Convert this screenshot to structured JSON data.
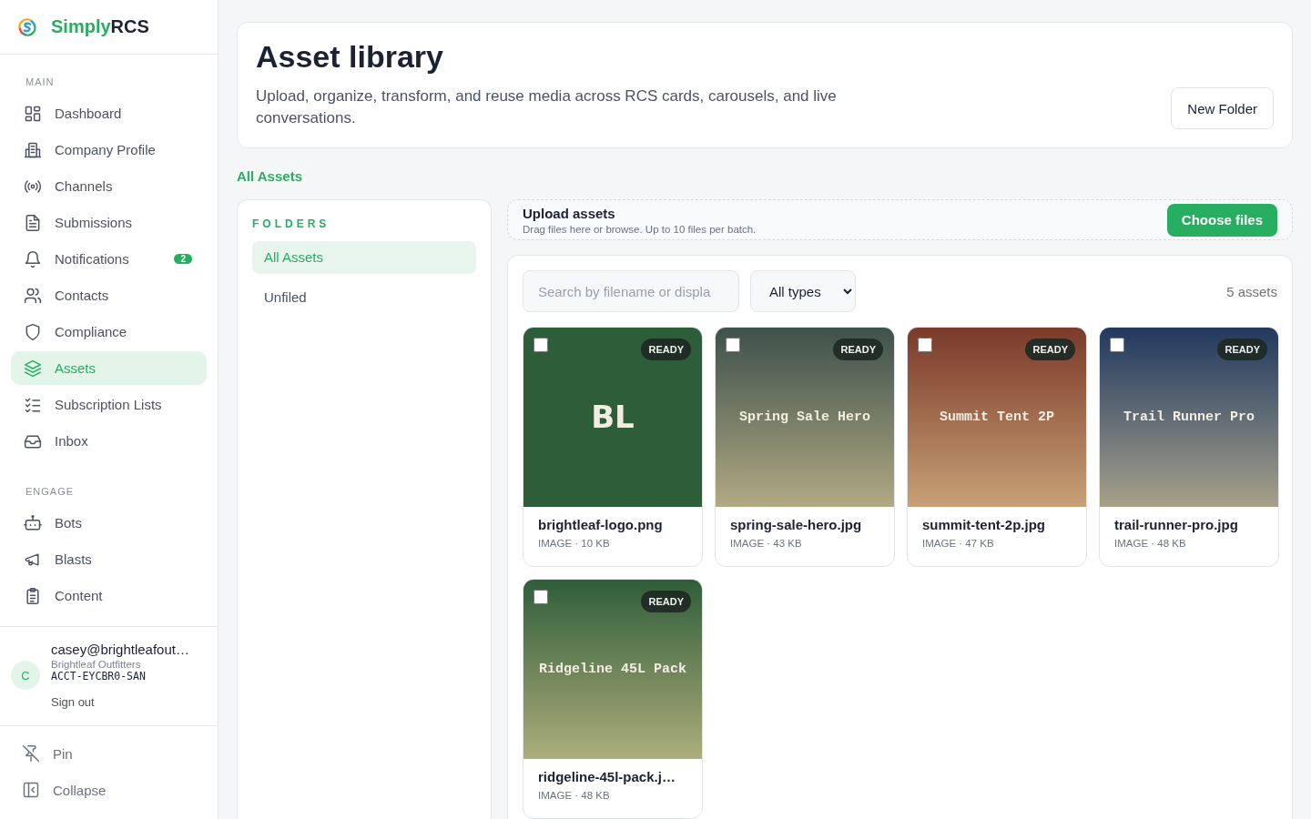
{
  "brand": {
    "name_part1": "Simply",
    "name_part2": "RCS"
  },
  "sidebar": {
    "sections": [
      {
        "label": "MAIN",
        "items": [
          {
            "label": "Dashboard",
            "selected": false
          },
          {
            "label": "Company Profile",
            "selected": false
          },
          {
            "label": "Channels",
            "selected": false
          },
          {
            "label": "Submissions",
            "selected": false
          },
          {
            "label": "Notifications",
            "selected": false,
            "badge": "2"
          },
          {
            "label": "Contacts",
            "selected": false
          },
          {
            "label": "Compliance",
            "selected": false
          },
          {
            "label": "Assets",
            "selected": true
          },
          {
            "label": "Subscription Lists",
            "selected": false
          },
          {
            "label": "Inbox",
            "selected": false
          }
        ]
      },
      {
        "label": "ENGAGE",
        "items": [
          {
            "label": "Bots",
            "selected": false
          },
          {
            "label": "Blasts",
            "selected": false
          },
          {
            "label": "Content",
            "selected": false
          }
        ]
      }
    ],
    "user": {
      "avatar": "C",
      "email": "casey@brightleafout…",
      "company": "Brightleaf Outfitters",
      "account": "ACCT-EYCBR0-SAN",
      "sign_out": "Sign out"
    },
    "footer": [
      {
        "label": "Pin"
      },
      {
        "label": "Collapse"
      }
    ]
  },
  "header": {
    "title": "Asset library",
    "subtitle": "Upload, organize, transform, and reuse media across RCS cards, carousels, and live conversations.",
    "button": "New Folder"
  },
  "breadcrumb": "All Assets",
  "folders": {
    "title": "FOLDERS",
    "items": [
      {
        "label": "All Assets",
        "selected": true
      },
      {
        "label": "Unfiled",
        "selected": false
      }
    ]
  },
  "upload": {
    "title": "Upload assets",
    "hint": "Drag files here or browse. Up to 10 files per batch.",
    "button": "Choose files"
  },
  "toolbar": {
    "search_placeholder": "Search by filename or displa",
    "type_filter": "All types",
    "count": "5 assets"
  },
  "assets": [
    {
      "kind": "logo",
      "caption": "BL",
      "color": "#2e5d3a",
      "status": "READY",
      "checked": false,
      "filename": "brightleaf-logo.png",
      "meta": "IMAGE · 10 KB"
    },
    {
      "kind": "banner",
      "caption": "Spring Sale Hero",
      "color": "#3e524b",
      "status": "READY",
      "checked": false,
      "filename": "spring-sale-hero.jpg",
      "meta": "IMAGE · 43 KB"
    },
    {
      "kind": "banner",
      "caption": "Summit Tent 2P",
      "color": "#7a3a2a",
      "status": "READY",
      "checked": false,
      "filename": "summit-tent-2p.jpg",
      "meta": "IMAGE · 47 KB"
    },
    {
      "kind": "banner",
      "caption": "Trail Runner Pro",
      "color": "#22395e",
      "status": "READY",
      "checked": false,
      "filename": "trail-runner-pro.jpg",
      "meta": "IMAGE · 48 KB"
    },
    {
      "kind": "banner",
      "caption": "Ridgeline 45L Pack",
      "color": "#2f5e3a",
      "status": "READY",
      "checked": false,
      "filename": "ridgeline-45l-pack.j…",
      "meta": "IMAGE · 48 KB"
    }
  ]
}
